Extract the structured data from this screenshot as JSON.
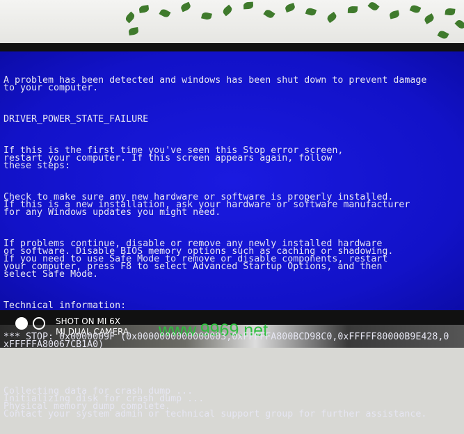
{
  "bsod": {
    "colors": {
      "background": "#1212c8",
      "text": "#e6e6f2"
    },
    "paragraphs": [
      "A problem has been detected and windows has been shut down to prevent damage\nto your computer.",
      "DRIVER_POWER_STATE_FAILURE",
      "If this is the first time you've seen this Stop error screen,\nrestart your computer. If this screen appears again, follow\nthese steps:",
      "Check to make sure any new hardware or software is properly installed.\nIf this is a new installation, ask your hardware or software manufacturer\nfor any Windows updates you might need.",
      "If problems continue, disable or remove any newly installed hardware\nor software. Disable BIOS memory options such as caching or shadowing.\nIf you need to use Safe Mode to remove or disable components, restart\nyour computer, press F8 to select Advanced Startup Options, and then\nselect Safe Mode.",
      "Technical information:",
      "*** STOP: 0x0000009F (0x0000000000000003,0xFFFFFA800BCD98C0,0xFFFFF80000B9E428,0\nxFFFFFA80067CB1A0)",
      "\n\nCollecting data for crash dump ...\nInitializing disk for crash dump ...\nPhysical memory dump complete.\nContact your system admin or technical support group for further assistance."
    ]
  },
  "watermark": {
    "line1": "SHOT ON MI 6X",
    "line2": "MI DUAL CAMERA",
    "site": "www.9969.net"
  }
}
